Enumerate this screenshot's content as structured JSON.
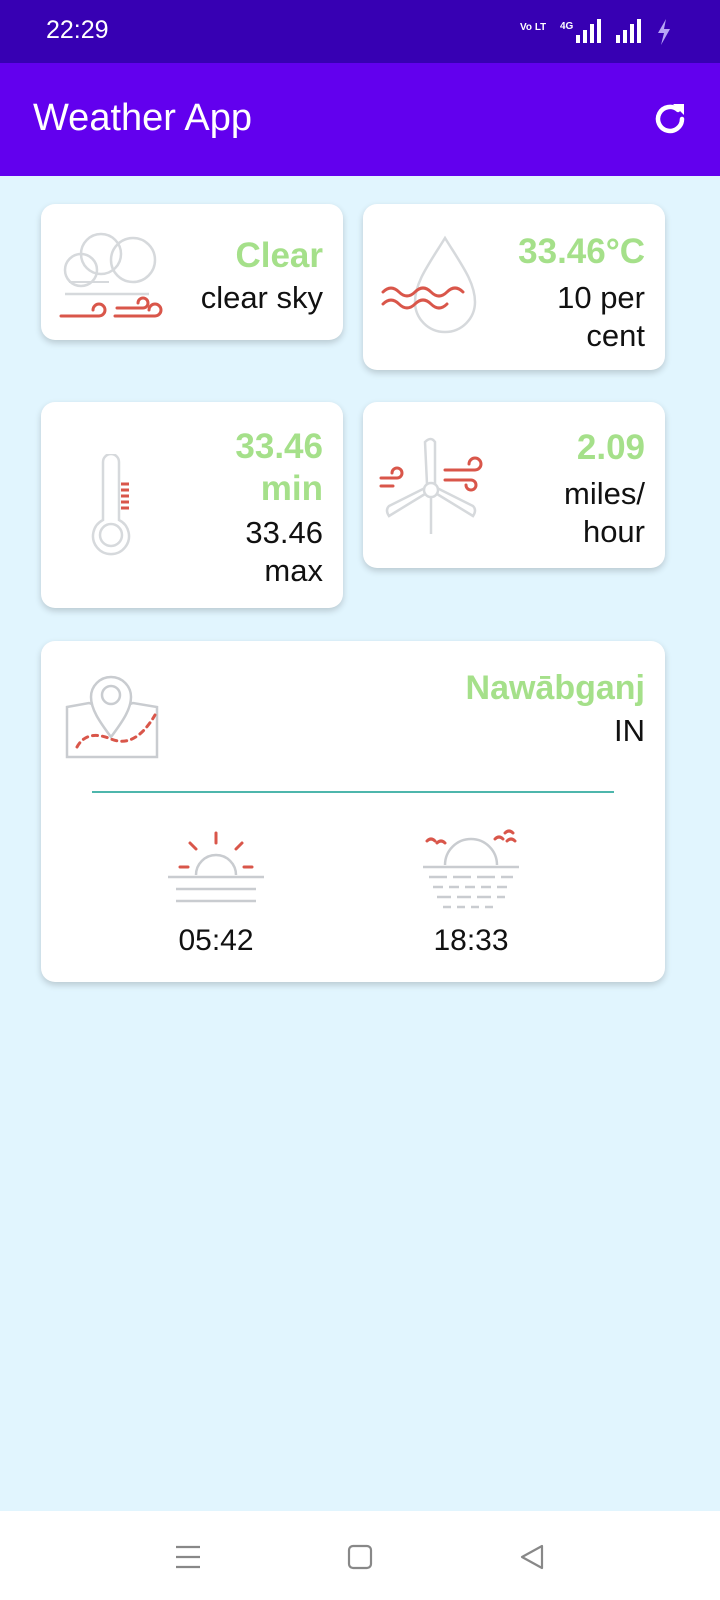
{
  "status_bar": {
    "time": "22:29",
    "icons": [
      "volte-icon",
      "4g-signal-icon",
      "signal-icon",
      "charging-icon"
    ],
    "volte_text": "Vo LTE",
    "network_text": "4G"
  },
  "app_bar": {
    "title": "Weather App",
    "refresh_icon": "refresh-icon"
  },
  "cards": {
    "condition": {
      "main": "Clear",
      "description": "clear sky",
      "icon": "cloud-wind-icon"
    },
    "humidity": {
      "temperature": "33.46°C",
      "humidity": "10 per cent",
      "icon": "humidity-drop-icon"
    },
    "temperature": {
      "min": "33.46 min",
      "max": "33.46 max",
      "icon": "thermometer-icon"
    },
    "wind": {
      "speed": "2.09",
      "unit": "miles/ hour",
      "icon": "wind-turbine-icon"
    }
  },
  "location": {
    "city": "Nawābganj",
    "country": "IN",
    "icon": "map-pin-icon",
    "sunrise": {
      "time": "05:42",
      "icon": "sunrise-icon"
    },
    "sunset": {
      "time": "18:33",
      "icon": "sunset-icon"
    }
  },
  "colors": {
    "status_bar": "#3700b3",
    "app_bar": "#6200ee",
    "background": "#e1f5fe",
    "accent_value": "#a5e08a",
    "icon_red": "#d9564a",
    "icon_gray": "#c9ccd0",
    "divider": "#4db6ac"
  },
  "nav_bar": {
    "buttons": [
      "menu-icon",
      "home-square-icon",
      "back-triangle-icon"
    ]
  }
}
